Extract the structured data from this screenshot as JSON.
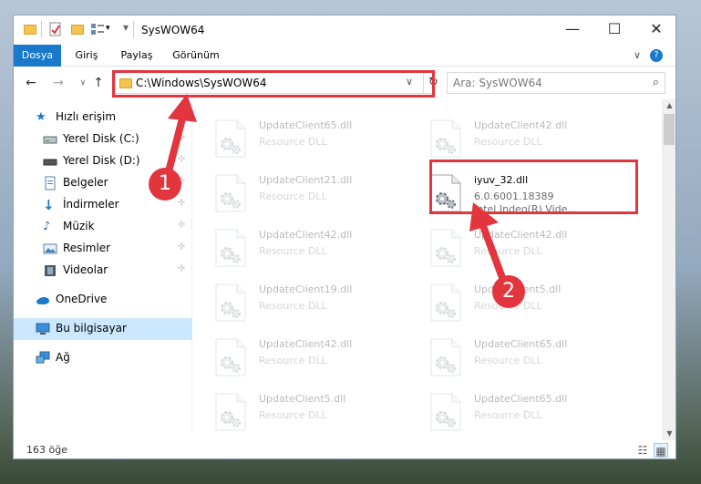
{
  "window": {
    "title": "SysWOW64",
    "controls": {
      "minimize": "—",
      "maximize": "☐",
      "close": "✕"
    }
  },
  "ribbon": {
    "tabs": [
      {
        "label": "Dosya"
      },
      {
        "label": "Giriş"
      },
      {
        "label": "Paylaş"
      },
      {
        "label": "Görünüm"
      }
    ],
    "chevron": "∨",
    "help": "?"
  },
  "address": {
    "path": "C:\\Windows\\SysWOW64",
    "chevron": "∨",
    "refresh": "↻"
  },
  "search": {
    "placeholder": "Ara: SysWOW64"
  },
  "nav": {
    "back": "←",
    "forward": "→",
    "up": "↑",
    "items": [
      {
        "label": "Hızlı erişim",
        "icon": "star-icon"
      },
      {
        "label": "Yerel Disk (C:)",
        "icon": "drive-icon",
        "pinned": true
      },
      {
        "label": "Yerel Disk (D:)",
        "icon": "drive-icon",
        "pinned": true
      },
      {
        "label": "Belgeler",
        "icon": "documents-icon",
        "pinned": true
      },
      {
        "label": "İndirmeler",
        "icon": "download-icon",
        "pinned": true
      },
      {
        "label": "Müzik",
        "icon": "music-icon",
        "pinned": true
      },
      {
        "label": "Resimler",
        "icon": "pictures-icon",
        "pinned": true
      },
      {
        "label": "Videolar",
        "icon": "videos-icon",
        "pinned": true
      },
      {
        "label": "OneDrive",
        "icon": "cloud-icon"
      },
      {
        "label": "Bu bilgisayar",
        "icon": "computer-icon",
        "selected": true
      },
      {
        "label": "Ağ",
        "icon": "network-icon"
      }
    ],
    "pin_glyph": "📌"
  },
  "files": [
    {
      "name": "UpdateClient65.dll",
      "desc": "Resource DLL"
    },
    {
      "name": "UpdateClient42.dll",
      "desc": "Resource DLL"
    },
    {
      "name": "UpdateClient21.dll",
      "desc": "Resource DLL"
    },
    {
      "name": "iyuv_32.dll",
      "desc": "6.0.6001.18389",
      "desc2": "Intel Indeo(R) Vide...",
      "highlight": true
    },
    {
      "name": "UpdateClient42.dll",
      "desc": "Resource DLL"
    },
    {
      "name": "UpdateClient42.dll",
      "desc": "Resource DLL"
    },
    {
      "name": "UpdateClient19.dll",
      "desc": "Resource DLL"
    },
    {
      "name": "UpdateClient5.dll",
      "desc": "Resource DLL"
    },
    {
      "name": "UpdateClient42.dll",
      "desc": "Resource DLL"
    },
    {
      "name": "UpdateClient65.dll",
      "desc": "Resource DLL"
    },
    {
      "name": "UpdateClient5.dll",
      "desc": "Resource DLL"
    },
    {
      "name": "UpdateClient65.dll",
      "desc": "Resource DLL"
    }
  ],
  "status": {
    "count": "163 öğe"
  },
  "annotations": {
    "badge1": "1",
    "badge2": "2",
    "color": "#e2353d"
  },
  "colors": {
    "accent": "#1979ca",
    "selection": "#cce8ff",
    "highlight": "#e2353d"
  }
}
